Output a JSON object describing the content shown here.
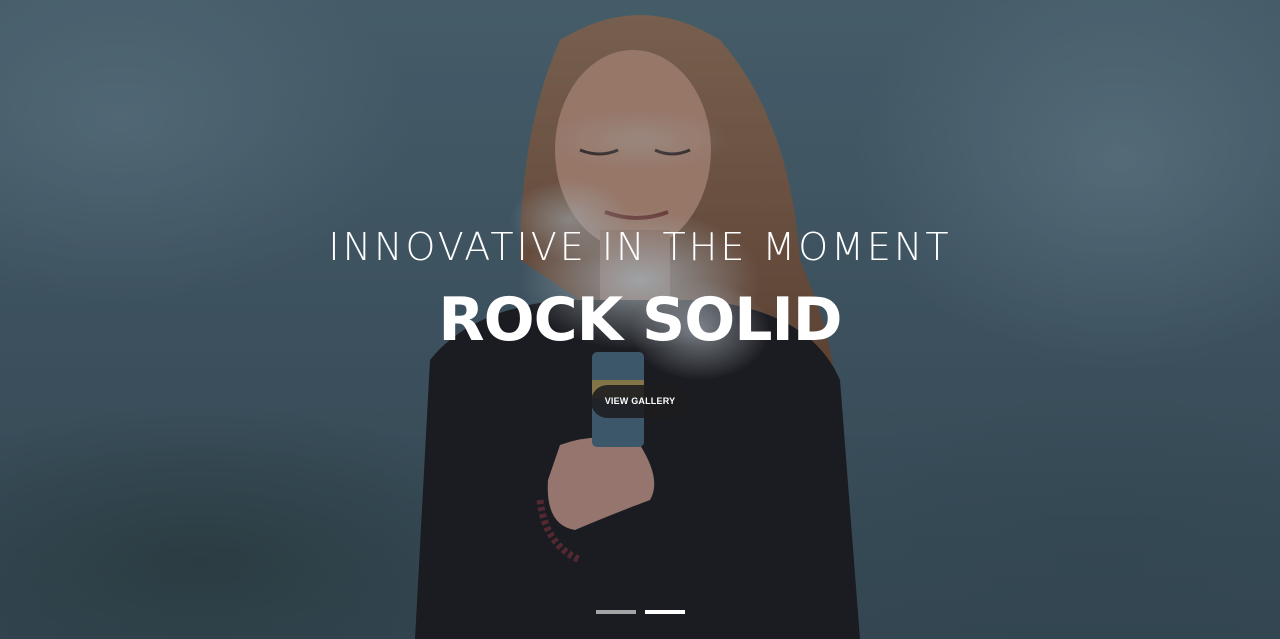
{
  "hero": {
    "subtitle": "INNOVATIVE IN THE MOMENT",
    "title": "ROCK SOLID",
    "cta_label": "VIEW GALLERY",
    "background_image": "woman-holding-smoke-flare-photo"
  },
  "slider": {
    "slide_count": 2,
    "active_slide": 2
  },
  "colors": {
    "text": "#ffffff",
    "button_bg": "#1c1c1e",
    "indicator_active": "#ffffff",
    "indicator_inactive": "#bfbfbf"
  }
}
